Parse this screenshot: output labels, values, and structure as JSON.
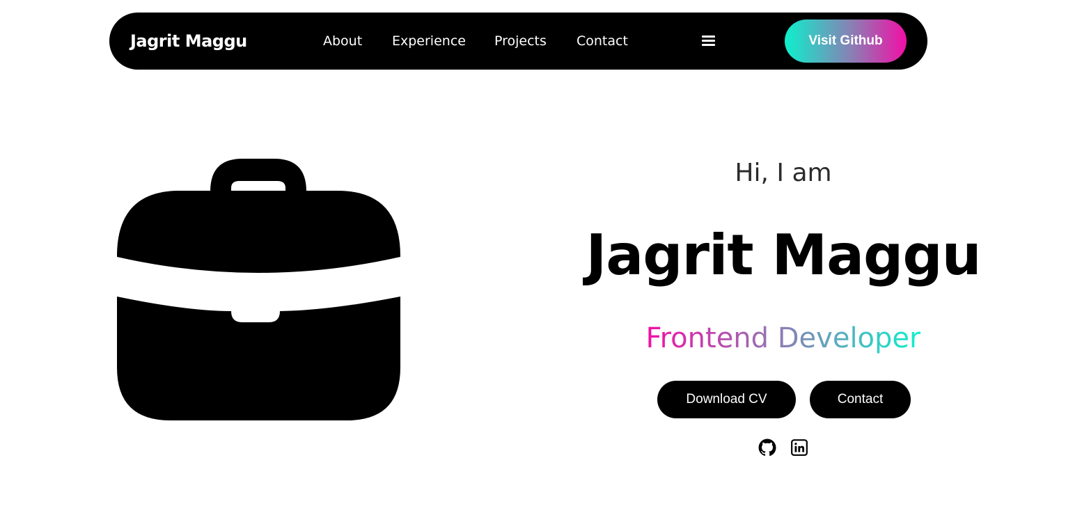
{
  "navbar": {
    "brand": "Jagrit Maggu",
    "links": [
      {
        "label": "About"
      },
      {
        "label": "Experience"
      },
      {
        "label": "Projects"
      },
      {
        "label": "Contact"
      }
    ],
    "menu_icon": "hamburger-menu-icon",
    "cta_label": "Visit Github"
  },
  "hero": {
    "image_icon": "briefcase-icon",
    "greeting": "Hi, I am",
    "name": "Jagrit Maggu",
    "role": "Frontend Developer",
    "buttons": {
      "download_cv": "Download CV",
      "contact": "Contact"
    },
    "social_icons": [
      "github-icon",
      "linkedin-icon"
    ]
  },
  "colors": {
    "background": "#ffffff",
    "dark": "#000000",
    "gradient_teal": "#0df0cc",
    "gradient_pink": "#f20fa6"
  }
}
